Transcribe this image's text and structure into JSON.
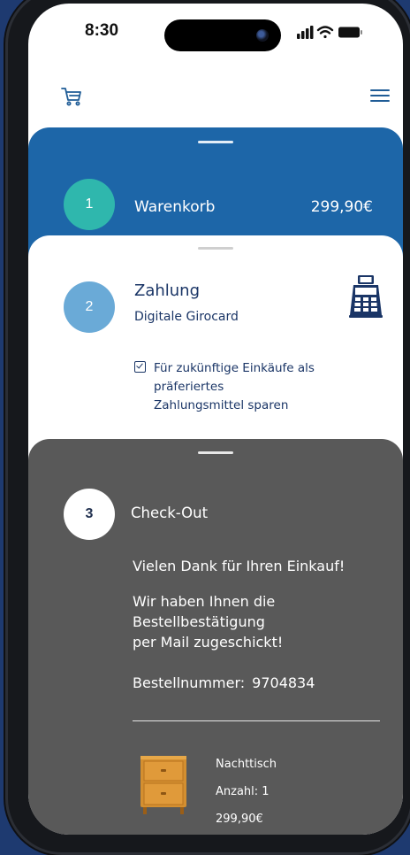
{
  "status_bar": {
    "time": "8:30"
  },
  "steps": {
    "cart": {
      "number": "1",
      "title": "Warenkorb",
      "price": "299,90€"
    },
    "payment": {
      "number": "2",
      "title": "Zahlung",
      "method": "Digitale Girocard",
      "save_option": {
        "checked": true,
        "lines": [
          "Für zukünftige Einkäufe als",
          "präferiertes",
          "Zahlungsmittel sparen"
        ]
      }
    },
    "checkout": {
      "number": "3",
      "title": "Check-Out",
      "thanks": "Vielen Dank für Ihren Einkauf!",
      "mail_lines": [
        "Wir haben Ihnen die",
        "Bestellbestätigung",
        "per Mail zugeschickt!"
      ],
      "order_label": "Bestellnummer:",
      "order_number": "9704834",
      "item": {
        "name": "Nachttisch",
        "quantity": "Anzahl: 1",
        "price": "299,90€"
      }
    }
  },
  "icons": {
    "cart": "shopping-cart-icon",
    "menu": "hamburger-menu-icon",
    "terminal": "card-terminal-icon",
    "signal": "cellular-signal-icon",
    "wifi": "wifi-icon",
    "battery": "battery-icon"
  },
  "colors": {
    "background": "#1e3a70",
    "step1_bg": "#1d66a8",
    "step1_circle": "#2fb7ad",
    "step2_circle": "#6aaad7",
    "step3_bg": "#595959",
    "text_navy": "#1a3566"
  }
}
